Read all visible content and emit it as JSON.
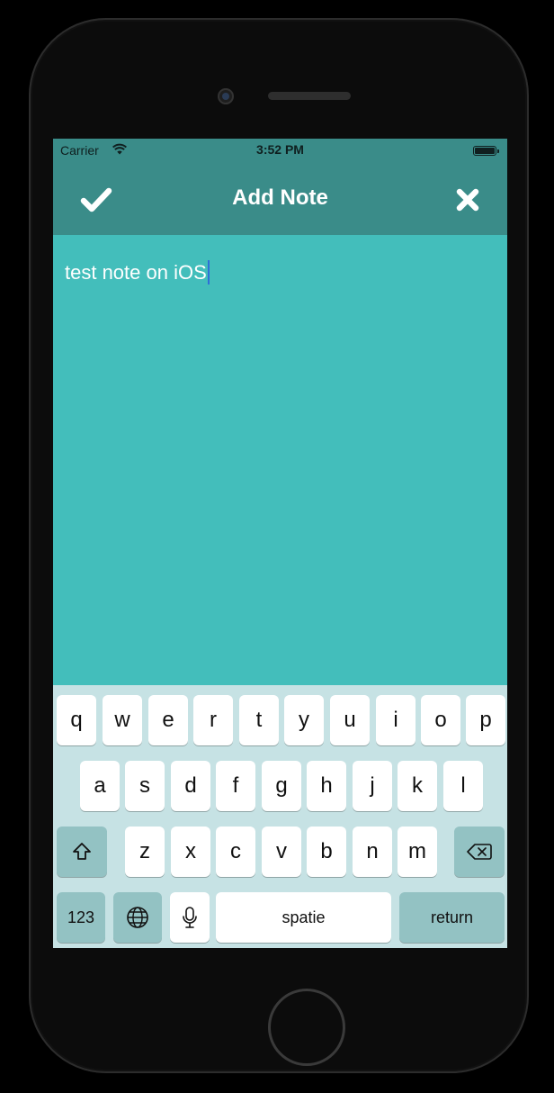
{
  "status_bar": {
    "carrier": "Carrier",
    "time": "3:52 PM"
  },
  "navbar": {
    "title": "Add Note",
    "confirm_icon": "checkmark-icon",
    "close_icon": "close-x-icon"
  },
  "note": {
    "text": "test note on iOS"
  },
  "keyboard": {
    "row1": [
      "q",
      "w",
      "e",
      "r",
      "t",
      "y",
      "u",
      "i",
      "o",
      "p"
    ],
    "row2": [
      "a",
      "s",
      "d",
      "f",
      "g",
      "h",
      "j",
      "k",
      "l"
    ],
    "row3": [
      "z",
      "x",
      "c",
      "v",
      "b",
      "n",
      "m"
    ],
    "numbers_label": "123",
    "space_label": "spatie",
    "return_label": "return",
    "icons": {
      "shift": "shift-icon",
      "delete": "delete-backspace-icon",
      "globe": "globe-icon",
      "mic": "microphone-icon"
    }
  },
  "colors": {
    "app_bar": "#3a8c89",
    "note_background": "#43bebb",
    "keyboard_background": "#c6e2e4"
  }
}
